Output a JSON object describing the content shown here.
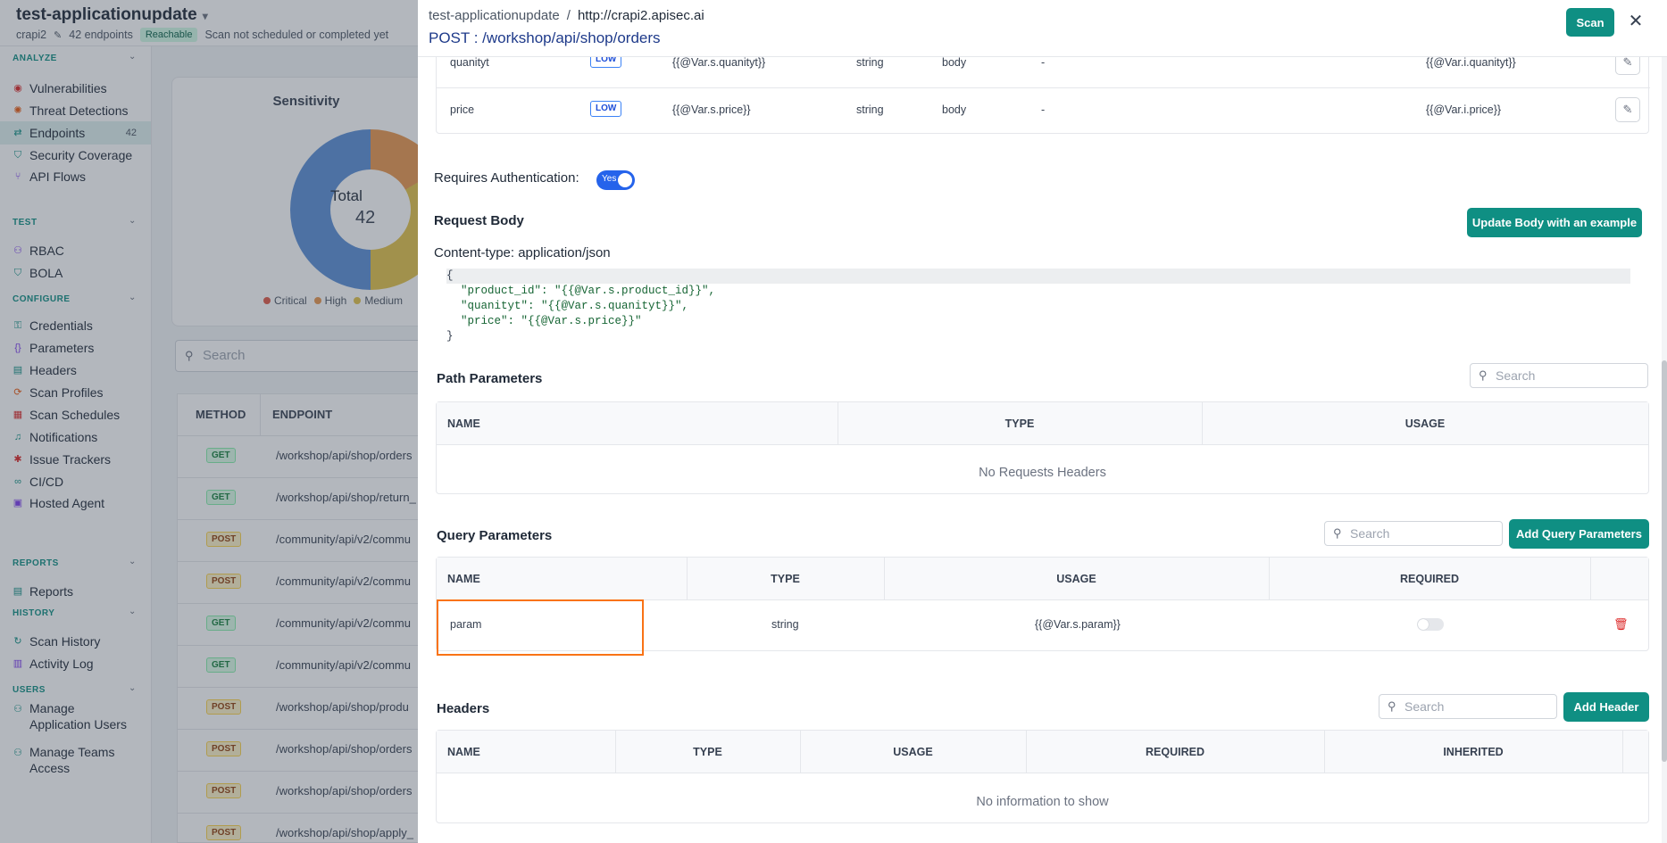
{
  "app": {
    "title": "test-applicationupdate",
    "subtitle_name": "crapi2",
    "endpoint_count": "42 endpoints",
    "badge": "Reachable",
    "scan_status": "Scan not scheduled or completed yet"
  },
  "sidebar": {
    "sections": {
      "analyze": "ANALYZE",
      "test": "TEST",
      "configure": "CONFIGURE",
      "reports": "REPORTS",
      "history": "HISTORY",
      "users": "USERS"
    },
    "items": {
      "vulnerabilities": "Vulnerabilities",
      "threat_detections": "Threat Detections",
      "endpoints": "Endpoints",
      "endpoints_count": "42",
      "security_coverage": "Security Coverage",
      "api_flows": "API Flows",
      "rbac": "RBAC",
      "bola": "BOLA",
      "credentials": "Credentials",
      "parameters": "Parameters",
      "headers": "Headers",
      "scan_profiles": "Scan Profiles",
      "scan_schedules": "Scan Schedules",
      "notifications": "Notifications",
      "issue_trackers": "Issue Trackers",
      "ci_cd": "CI/CD",
      "hosted_agent": "Hosted Agent",
      "reports": "Reports",
      "scan_history": "Scan History",
      "activity_log": "Activity Log",
      "manage_app_users_1": "Manage",
      "manage_app_users_2": "Application Users",
      "manage_teams_1": "Manage Teams",
      "manage_teams_2": "Access"
    }
  },
  "background": {
    "sensitivity_title": "Sensitivity",
    "total_label": "Total",
    "total_value": "42",
    "legend": [
      "Critical",
      "High",
      "Medium"
    ],
    "legend_colors": [
      "#e05a47",
      "#e8974e",
      "#e3c24a"
    ],
    "search_placeholder": "Search",
    "table_headers": [
      "METHOD",
      "ENDPOINT"
    ],
    "rows": [
      {
        "method": "GET",
        "endpoint": "/workshop/api/shop/orders"
      },
      {
        "method": "GET",
        "endpoint": "/workshop/api/shop/return_"
      },
      {
        "method": "POST",
        "endpoint": "/community/api/v2/commu"
      },
      {
        "method": "POST",
        "endpoint": "/community/api/v2/commu"
      },
      {
        "method": "GET",
        "endpoint": "/community/api/v2/commu"
      },
      {
        "method": "GET",
        "endpoint": "/community/api/v2/commu"
      },
      {
        "method": "POST",
        "endpoint": "/workshop/api/shop/produ"
      },
      {
        "method": "POST",
        "endpoint": "/workshop/api/shop/orders"
      },
      {
        "method": "POST",
        "endpoint": "/workshop/api/shop/orders"
      },
      {
        "method": "POST",
        "endpoint": "/workshop/api/shop/apply_"
      }
    ]
  },
  "drawer": {
    "breadcrumb_app": "test-applicationupdate",
    "breadcrumb_sep": "/",
    "breadcrumb_url": "http://crapi2.apisec.ai",
    "endpoint_title": "POST :  /workshop/api/shop/orders",
    "scan_label": "Scan",
    "close_glyph": "✕",
    "body_params": [
      {
        "name": "quanityt",
        "sensitivity": "LOW",
        "value": "{{@Var.s.quanityt}}",
        "type": "string",
        "location": "body",
        "dash": "-",
        "usage": "{{@Var.i.quanityt}}"
      },
      {
        "name": "price",
        "sensitivity": "LOW",
        "value": "{{@Var.s.price}}",
        "type": "string",
        "location": "body",
        "dash": "-",
        "usage": "{{@Var.i.price}}"
      }
    ],
    "auth_label": "Requires Authentication:",
    "auth_toggle": "Yes",
    "request_body_title": "Request Body",
    "update_body_label": "Update Body with an example",
    "content_type": "Content-type: application/json",
    "code": {
      "open": "{",
      "lines": [
        "\"product_id\": \"{{@Var.s.product_id}}\",",
        "\"quanityt\": \"{{@Var.s.quanityt}}\",",
        "\"price\": \"{{@Var.s.price}}\""
      ],
      "close": "}"
    },
    "path_params": {
      "title": "Path Parameters",
      "search_placeholder": "Search",
      "headers": [
        "NAME",
        "TYPE",
        "USAGE"
      ],
      "empty": "No Requests Headers"
    },
    "query_params": {
      "title": "Query Parameters",
      "search_placeholder": "Search",
      "add_label": "Add Query Parameters",
      "headers": [
        "NAME",
        "TYPE",
        "USAGE",
        "REQUIRED"
      ],
      "rows": [
        {
          "name": "param",
          "type": "string",
          "usage": "{{@Var.s.param}}",
          "required": false
        }
      ]
    },
    "headers_section": {
      "title": "Headers",
      "search_placeholder": "Search",
      "add_label": "Add Header",
      "headers": [
        "NAME",
        "TYPE",
        "USAGE",
        "REQUIRED",
        "INHERITED"
      ],
      "empty": "No information to show"
    }
  }
}
